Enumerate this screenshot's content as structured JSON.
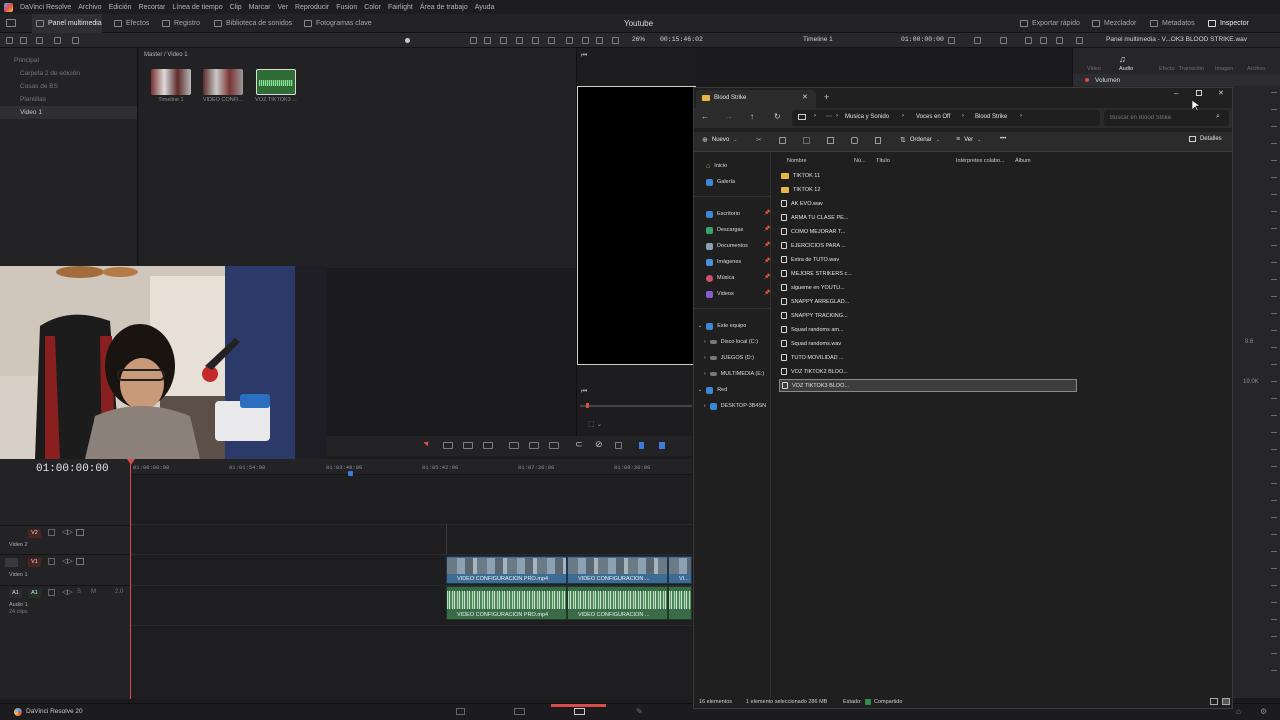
{
  "menubar": {
    "app_name": "DaVinci Resolve",
    "items": [
      "Archivo",
      "Edición",
      "Recortar",
      "Línea de tiempo",
      "Clip",
      "Marcar",
      "Ver",
      "Reproducir",
      "Fusion",
      "Color",
      "Fairlight",
      "Área de trabajo",
      "Ayuda"
    ],
    "project_title": "Youtube"
  },
  "toolbar": {
    "left": [
      "Panel multimedia",
      "Efectos",
      "Registro",
      "Biblioteca de sonidos",
      "Fotogramas clave"
    ],
    "right": [
      "Exportar rápido",
      "Mezclador",
      "Metadatos",
      "Inspector"
    ]
  },
  "viewer_bar": {
    "zoom": "26%",
    "source_timecode": "00:15:46:02",
    "timeline_name": "Timeline 1",
    "record_timecode": "01:00:00:00",
    "inspector_title": "Panel multimedia - V...OK3 BLOOD STRIKE.wav"
  },
  "bins": {
    "items": [
      "Principal",
      "Carpeta 2 de edición",
      "Cosas de BS",
      "Plantillas",
      "Video 1"
    ],
    "selected": "Video 1"
  },
  "media_pool": {
    "path": "Master / Video 1",
    "clips": [
      "Timeline 1",
      "VIDEO CONFI...",
      "VOZ TIKTOK3 ..."
    ]
  },
  "inspector": {
    "tabs": [
      "Video",
      "Audio",
      "Efecto",
      "Transición",
      "Imagen",
      "Archivo"
    ],
    "active_tab": "Audio",
    "section": "Volumen",
    "value1": "8.6",
    "value2": "19.0K"
  },
  "timeline": {
    "timecode": "01:00:00:00",
    "ruler": [
      "01:00:00:00",
      "01:01:54:00",
      "01:03:48:00",
      "01:05:42:00",
      "01:07:36:00",
      "01:09:30:00"
    ],
    "tracks": [
      {
        "tag": "V2",
        "name": "Video 2"
      },
      {
        "tag": "V1",
        "name": "Video 1"
      },
      {
        "tag": "A1",
        "name": "Audio 1",
        "sub": "24 clips",
        "level": "2.0"
      }
    ],
    "clip_label": "VIDEO CONFIGURACION PRO.mp4",
    "clip_label_short": "VIDEO CONFIGURACION ...",
    "clip_label_tiny": "VI..."
  },
  "statusbar": {
    "app": "DaVinci Resolve 20"
  },
  "explorer": {
    "tab_title": "Blood Strike",
    "new_tab": "+",
    "breadcrumb": [
      "Musica y Sonido",
      "Voces en Off",
      "Blood Strike"
    ],
    "search_placeholder": "Buscar en Blood Strike",
    "commands": {
      "new": "Nuevo",
      "sort": "Ordenar",
      "view": "Ver",
      "more": "•••",
      "details": "Detalles"
    },
    "sidebar": {
      "top": [
        "Inicio",
        "Galería"
      ],
      "pinned": [
        "Escritorio",
        "Descargas",
        "Documentos",
        "Imágenes",
        "Música",
        "Videos"
      ],
      "this_pc": "Este equipo",
      "drives": [
        "Disco local (C:)",
        "JUEGOS (D:)",
        "MULTIMEDIA (E:)"
      ],
      "network": "Red",
      "network_items": [
        "DESKTOP-3B4SN"
      ]
    },
    "columns": [
      "Nombre",
      "Nú...",
      "Título",
      "Intérpretes colabo...",
      "Álbum"
    ],
    "files": [
      {
        "name": "TIKTOK 11",
        "type": "folder"
      },
      {
        "name": "TIKTOK 12",
        "type": "folder"
      },
      {
        "name": "AK EVO.wav",
        "type": "file"
      },
      {
        "name": "ARMA TU CLASE PE...",
        "type": "file"
      },
      {
        "name": "COMO MEJORAR T...",
        "type": "file"
      },
      {
        "name": "EJERCICIOS PARA ...",
        "type": "file"
      },
      {
        "name": "Extra de TUTO.wav",
        "type": "file"
      },
      {
        "name": "MEJORE STRIKERS c...",
        "type": "file"
      },
      {
        "name": "sigueme en YOUTU...",
        "type": "file"
      },
      {
        "name": "SNAPPY ARREGLAD...",
        "type": "file"
      },
      {
        "name": "SNAPPY TRACKING...",
        "type": "file"
      },
      {
        "name": "Squad randoms am...",
        "type": "file"
      },
      {
        "name": "Squad randoms.wav",
        "type": "file"
      },
      {
        "name": "TUTO MOVILIDAD ...",
        "type": "file"
      },
      {
        "name": "VOZ TIKTOK2 BLOO...",
        "type": "file"
      },
      {
        "name": "VOZ TIKTOK3 BLOO...",
        "type": "file",
        "selected": true
      }
    ],
    "status": {
      "count": "16 elementos",
      "selection": "1 elemento seleccionado 286 MB",
      "state": "Estado:",
      "shared": "Compartido"
    }
  },
  "colors": {
    "resolve_bg": "#1b1b1d",
    "clip_video": "#3e6b92",
    "clip_audio": "#3a6b46",
    "playhead": "#d94c4c",
    "folder": "#e7b746"
  }
}
